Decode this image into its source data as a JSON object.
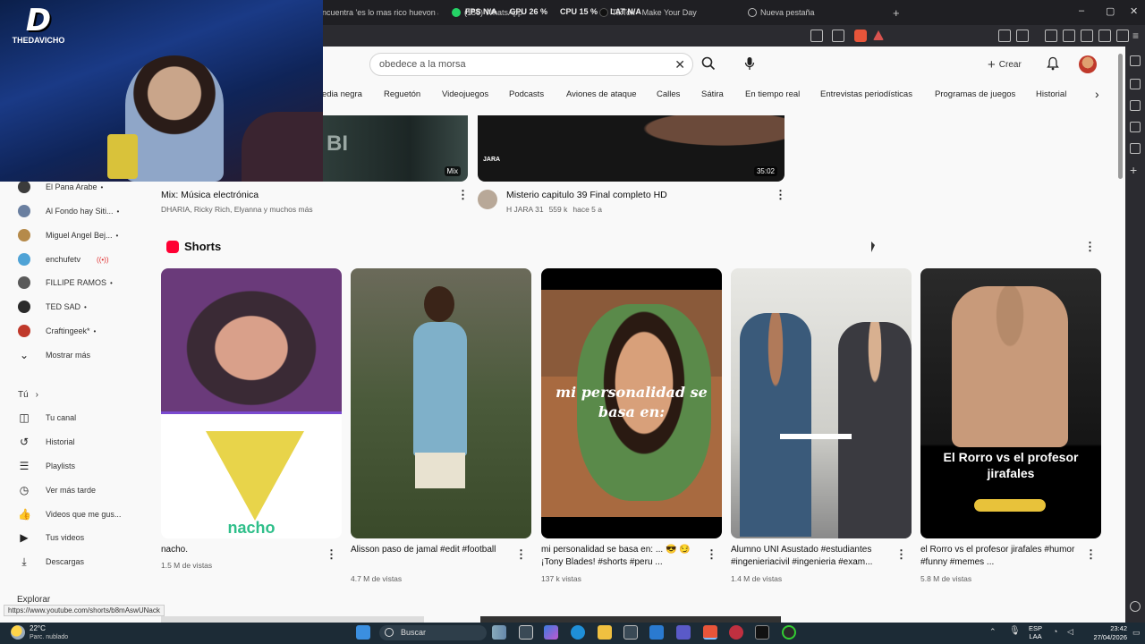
{
  "browser": {
    "tabs": [
      {
        "label": "ncuentra 'es lo mas rico huevon au"
      },
      {
        "label": "(156) WhatsApp"
      },
      {
        "label": "TikTok - Make Your Day"
      },
      {
        "label": "Nueva pestaña"
      }
    ],
    "overlay_stats": {
      "fps": "FPS N/A",
      "gpu": "GPU 26 %",
      "cpu": "CPU 15 %",
      "lat": "LAT N/A"
    },
    "new_tab": "+",
    "window_controls": {
      "minimize": "–",
      "maximize": "▢",
      "close": "✕"
    }
  },
  "stream_overlay": {
    "logo_text": "THEDAVICHO",
    "logo_mark": "D"
  },
  "header": {
    "search_query": "obedece a la morsa",
    "create_label": "Crear"
  },
  "chips": [
    "edia negra",
    "Reguetón",
    "Videojuegos",
    "Podcasts",
    "Aviones de ataque",
    "Calles",
    "Sátira",
    "En tiempo real",
    "Entrevistas periodísticas",
    "Programas de juegos",
    "Historial"
  ],
  "sidebar": {
    "subscriptions": [
      {
        "label": "El Pana Arabe",
        "color": "#3b3b3b",
        "indicator": "•"
      },
      {
        "label": "Al Fondo hay Siti...",
        "color": "#6a7fa0",
        "indicator": "•"
      },
      {
        "label": "Miguel Angel Bej...",
        "color": "#b58a4a",
        "indicator": "•"
      },
      {
        "label": "enchufetv",
        "color": "#4fa3d6",
        "indicator": "((•))"
      },
      {
        "label": "FILLIPE RAMOS",
        "color": "#5a5a5a",
        "indicator": "•"
      },
      {
        "label": "TED SAD",
        "color": "#2a2a2a",
        "indicator": "•"
      },
      {
        "label": "Craftingeek*",
        "color": "#c0392b",
        "indicator": "•"
      }
    ],
    "show_more": "Mostrar más",
    "you_header": "Tú",
    "you_items": [
      {
        "label": "Tu canal",
        "icon": "person-icon"
      },
      {
        "label": "Historial",
        "icon": "history-icon"
      },
      {
        "label": "Playlists",
        "icon": "playlist-icon"
      },
      {
        "label": "Ver más tarde",
        "icon": "clock-icon"
      },
      {
        "label": "Videos que me gus...",
        "icon": "thumbs-up-icon"
      },
      {
        "label": "Tus videos",
        "icon": "play-box-icon"
      },
      {
        "label": "Descargas",
        "icon": "download-icon"
      }
    ],
    "explore_header": "Explorar"
  },
  "videos": [
    {
      "title": "Mix: Música electrónica",
      "meta": "DHARIA, Ricky Rich, Elyanna y muchos más",
      "badge": "Mix"
    },
    {
      "title": "Misterio capitulo 39 Final completo HD",
      "channel": "H JARA 31",
      "views": "559 k",
      "age": "hace 5 a",
      "duration": "35:02",
      "thumb_label": "JARA"
    }
  ],
  "shorts": {
    "section_title": "Shorts",
    "items": [
      {
        "title": "nacho.",
        "views": "1.5 M de vistas",
        "overlay": "nacho"
      },
      {
        "title": "Alisson paso de jamal #edit #football",
        "views": "4.7 M de vistas",
        "overlay": ""
      },
      {
        "title": "mi personalidad se basa en: ... 😎 😏¡Tony Blades! #shorts #peru ...",
        "views": "137 k vistas",
        "overlay": "mi personalidad se basa en:"
      },
      {
        "title": "Alumno UNI Asustado #estudiantes #ingenieriacivil #ingenieria #exam...",
        "views": "1.4 M de vistas",
        "overlay": ""
      },
      {
        "title": "el Rorro vs el profesor jirafales #humor #funny #memes ...",
        "views": "5.8 M de vistas",
        "overlay": "El Rorro vs el profesor jirafales"
      }
    ]
  },
  "status_url": "https://www.youtube.com/shorts/b8mAswUNack",
  "taskbar": {
    "weather_temp": "22°C",
    "weather_desc": "Parc. nublado",
    "search_label": "Buscar",
    "lang": "ESP",
    "lang_sub": "LAA",
    "time": "23:42",
    "date": "27/04/2026"
  }
}
